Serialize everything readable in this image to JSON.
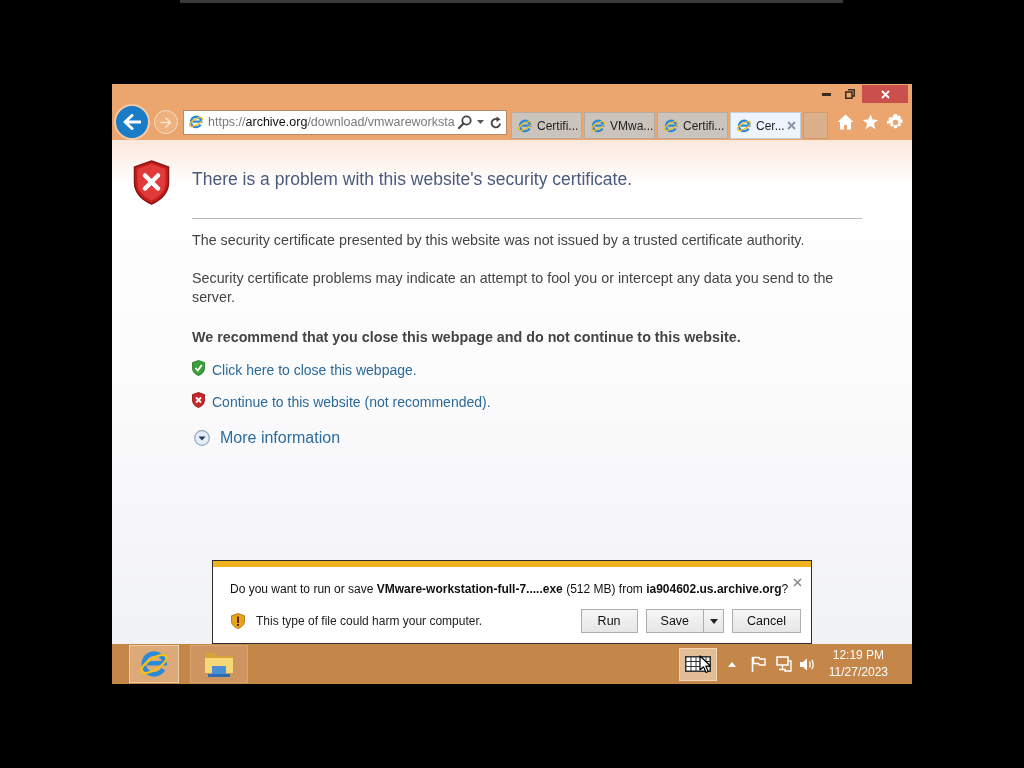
{
  "browser": {
    "address": {
      "scheme": "https://",
      "host": "archive.org",
      "path": "/download/vmwareworksta"
    },
    "tabs": [
      {
        "label": "Certifi...",
        "selected": false
      },
      {
        "label": "VMwa...",
        "selected": false
      },
      {
        "label": "Certifi...",
        "selected": false
      },
      {
        "label": "Cer...",
        "selected": true
      }
    ]
  },
  "page": {
    "heading": "There is a problem with this website's security certificate.",
    "paragraphs": [
      "The security certificate presented by this website was not issued by a trusted certificate authority.",
      "Security certificate problems may indicate an attempt to fool you or intercept any data you send to the server."
    ],
    "recommendation": "We recommend that you close this webpage and do not continue to this website.",
    "links": [
      {
        "kind": "safe",
        "text": "Click here to close this webpage."
      },
      {
        "kind": "unsafe",
        "text": "Continue to this website (not recommended)."
      }
    ],
    "more_info": {
      "label": "More information",
      "expanded": false
    }
  },
  "download_bar": {
    "message": "Do you want to run or save **VMware-workstation-full-7.....exe** (512 MB) from **ia904602.us.archive.org**?",
    "warning": "This type of file could harm your computer.",
    "buttons": [
      {
        "label": "Run",
        "kind": "plain"
      },
      {
        "label": "Save",
        "kind": "split"
      },
      {
        "label": "Cancel",
        "kind": "plain"
      }
    ]
  },
  "taskbar": {
    "time": "12:19 PM",
    "date": "11/27/2023"
  }
}
